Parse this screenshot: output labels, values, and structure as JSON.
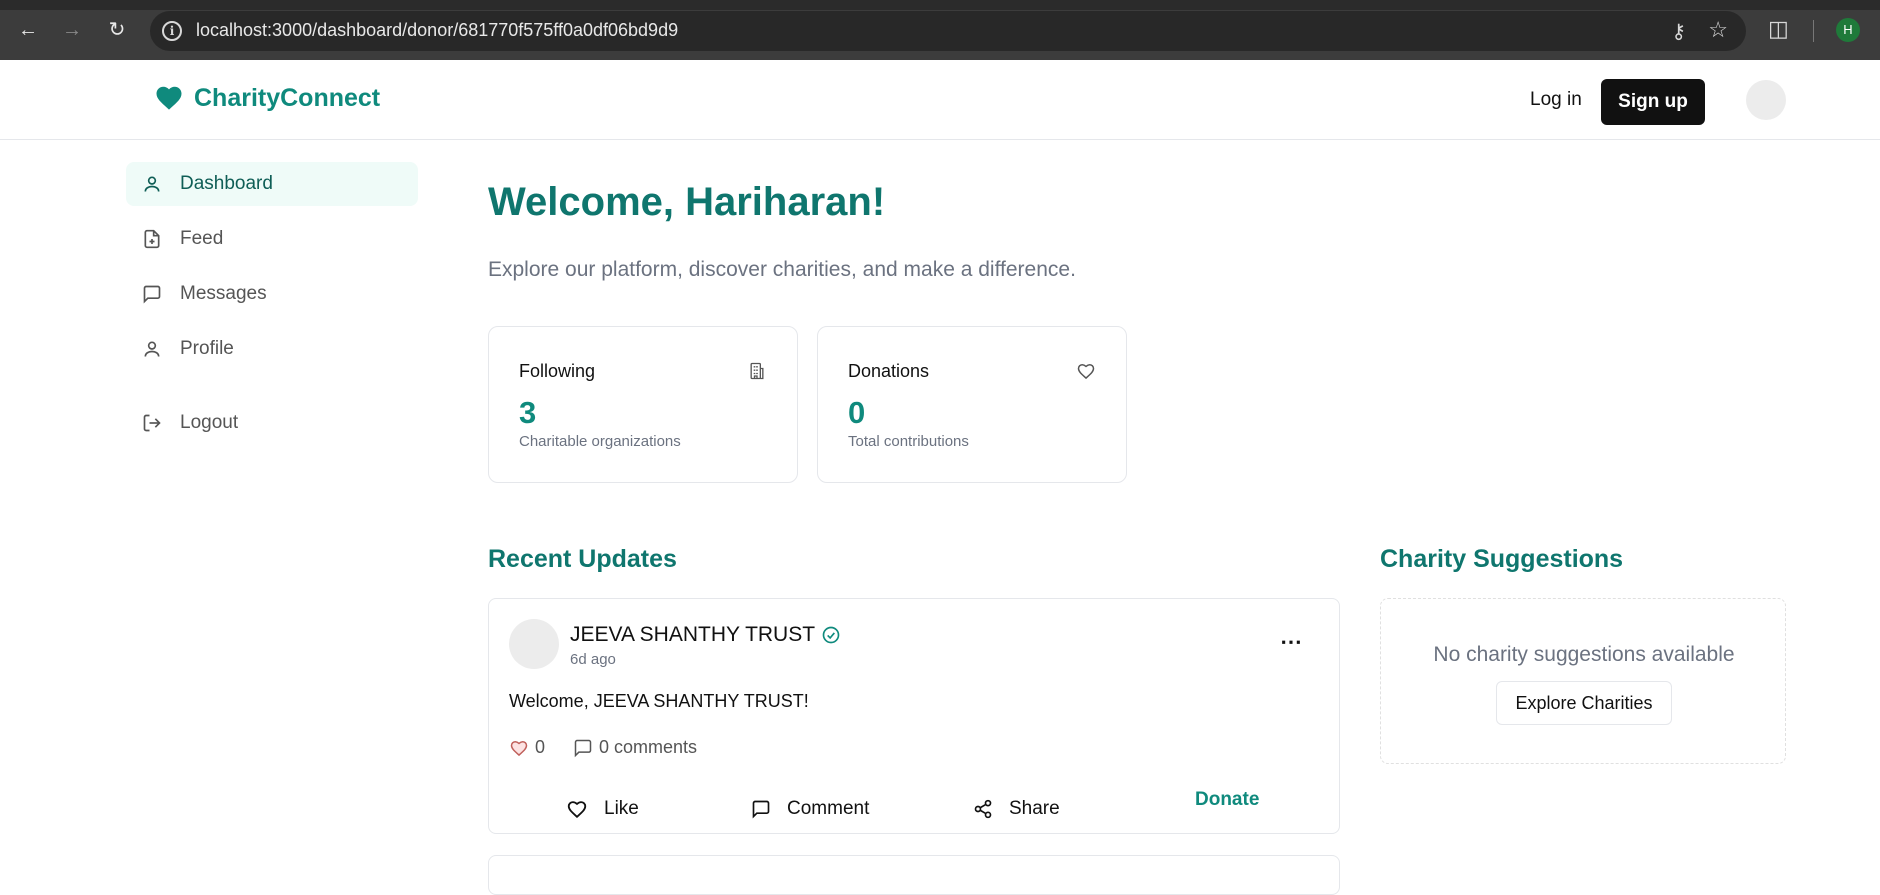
{
  "browser": {
    "url": "localhost:3000/dashboard/donor/681770f575ff0a0df06bd9d9",
    "profile_initial": "H"
  },
  "header": {
    "brand": "CharityConnect",
    "login_label": "Log in",
    "signup_label": "Sign up"
  },
  "sidebar": {
    "items": [
      {
        "label": "Dashboard",
        "icon": "user-icon",
        "active": true
      },
      {
        "label": "Feed",
        "icon": "file-plus-icon",
        "active": false
      },
      {
        "label": "Messages",
        "icon": "message-square-icon",
        "active": false
      },
      {
        "label": "Profile",
        "icon": "user-icon",
        "active": false
      }
    ],
    "logout_label": "Logout"
  },
  "main": {
    "welcome": "Welcome, Hariharan!",
    "subtitle": "Explore our platform, discover charities, and make a difference.",
    "stats": [
      {
        "label": "Following",
        "value": "3",
        "desc": "Charitable organizations",
        "icon": "building-icon"
      },
      {
        "label": "Donations",
        "value": "0",
        "desc": "Total contributions",
        "icon": "heart-icon"
      }
    ],
    "recent_title": "Recent Updates",
    "suggestions_title": "Charity Suggestions"
  },
  "posts": [
    {
      "author": "JEEVA SHANTHY TRUST",
      "time": "6d ago",
      "body": "Welcome, JEEVA SHANTHY TRUST!",
      "likes": "0",
      "comments": "0 comments",
      "actions": {
        "like": "Like",
        "comment": "Comment",
        "share": "Share",
        "donate": "Donate"
      }
    }
  ],
  "suggestions": {
    "empty_text": "No charity suggestions available",
    "explore_label": "Explore Charities"
  },
  "colors": {
    "brand": "#0f8a7d",
    "heading": "#0f766e",
    "active_bg": "#effbf8"
  }
}
